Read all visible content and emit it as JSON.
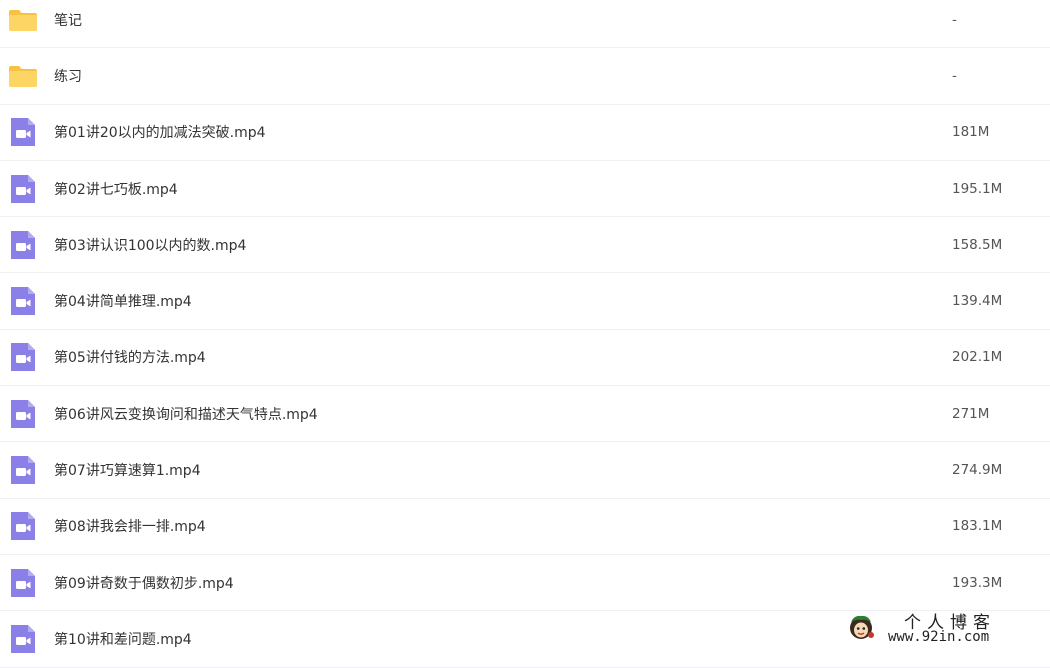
{
  "colors": {
    "folder_icon": "#fcd565",
    "folder_icon_tab": "#f5c244",
    "video_icon": "#8b7fe8",
    "divider": "#eef0f4",
    "text": "#333333",
    "size_text": "#555555"
  },
  "files": [
    {
      "type": "folder",
      "icon": "folder-icon",
      "name": "笔记",
      "size": "-"
    },
    {
      "type": "folder",
      "icon": "folder-icon",
      "name": "练习",
      "size": "-"
    },
    {
      "type": "video",
      "icon": "video-file-icon",
      "name": "第01讲20以内的加减法突破.mp4",
      "size": "181M"
    },
    {
      "type": "video",
      "icon": "video-file-icon",
      "name": "第02讲七巧板.mp4",
      "size": "195.1M"
    },
    {
      "type": "video",
      "icon": "video-file-icon",
      "name": "第03讲认识100以内的数.mp4",
      "size": "158.5M"
    },
    {
      "type": "video",
      "icon": "video-file-icon",
      "name": "第04讲简单推理.mp4",
      "size": "139.4M"
    },
    {
      "type": "video",
      "icon": "video-file-icon",
      "name": "第05讲付钱的方法.mp4",
      "size": "202.1M"
    },
    {
      "type": "video",
      "icon": "video-file-icon",
      "name": "第06讲风云变换询问和描述天气特点.mp4",
      "size": "271M"
    },
    {
      "type": "video",
      "icon": "video-file-icon",
      "name": "第07讲巧算速算1.mp4",
      "size": "274.9M"
    },
    {
      "type": "video",
      "icon": "video-file-icon",
      "name": "第08讲我会排一排.mp4",
      "size": "183.1M"
    },
    {
      "type": "video",
      "icon": "video-file-icon",
      "name": "第09讲奇数于偶数初步.mp4",
      "size": "193.3M"
    },
    {
      "type": "video",
      "icon": "video-file-icon",
      "name": "第10讲和差问题.mp4",
      "size": ""
    }
  ],
  "watermark": {
    "title": "个人博客",
    "url": "www.92in.com"
  }
}
